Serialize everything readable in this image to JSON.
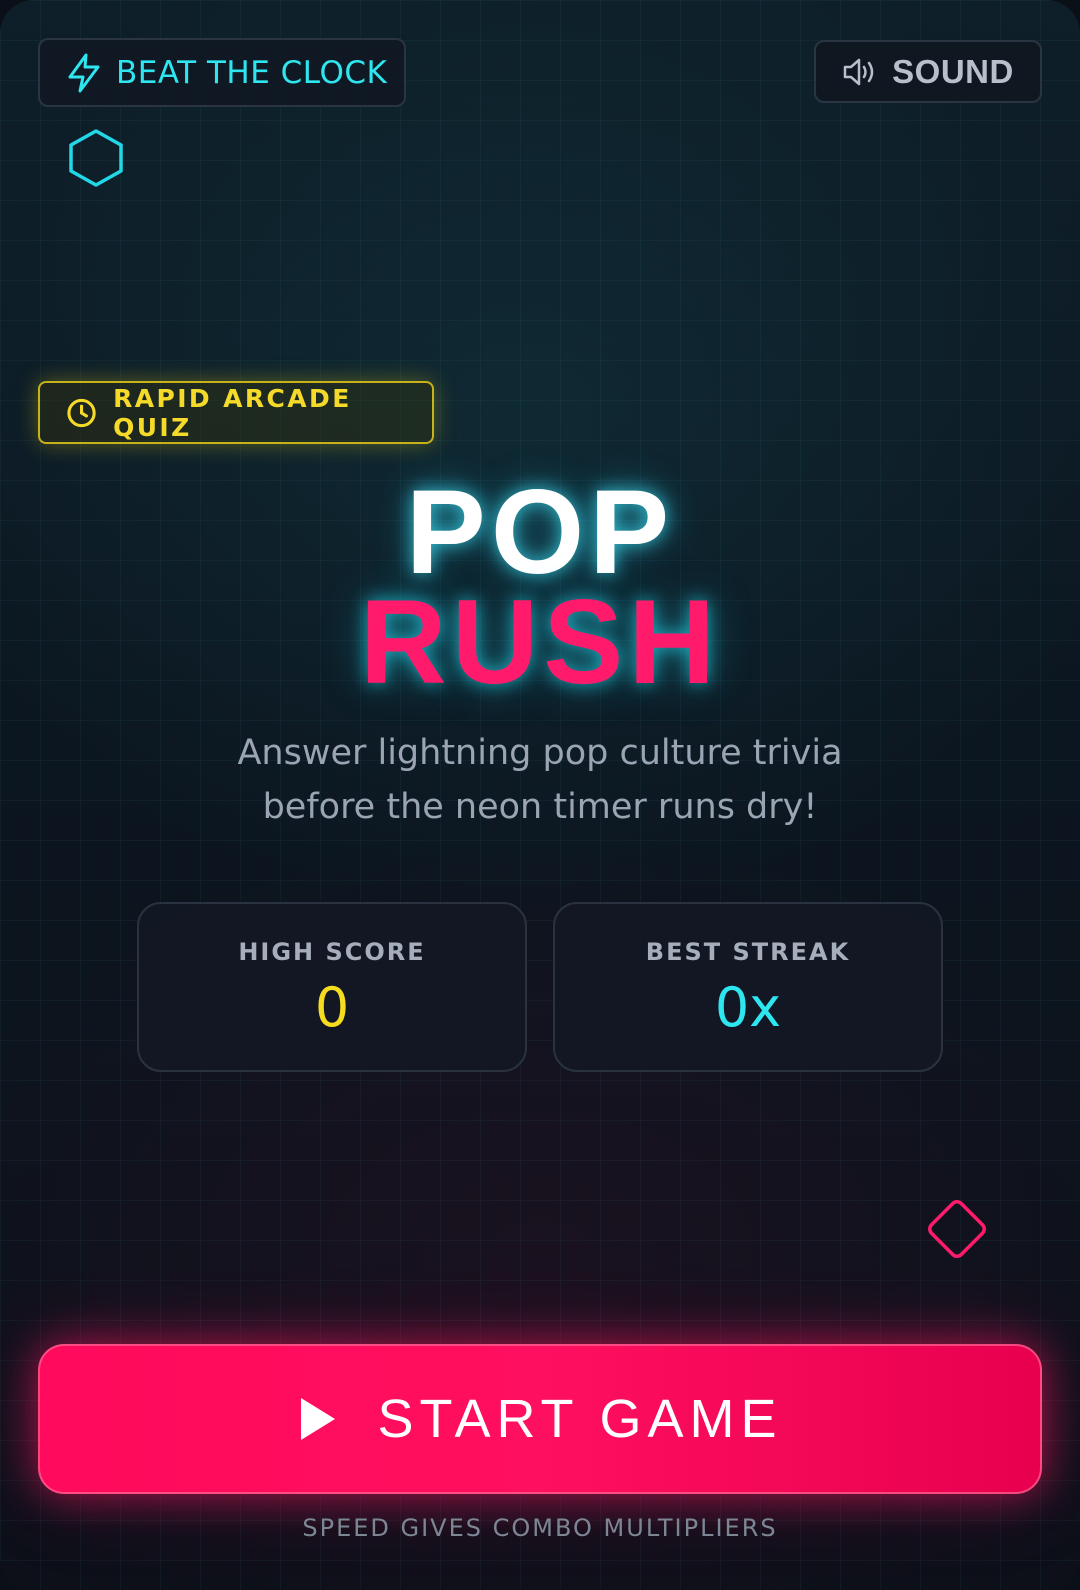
{
  "header": {
    "mode_label": "BEAT THE CLOCK",
    "sound_label": "SOUND"
  },
  "badge": {
    "label": "RAPID ARCADE QUIZ"
  },
  "title": {
    "line1": "POP",
    "line2": "RUSH"
  },
  "tagline": {
    "line1": "Answer lightning pop culture trivia",
    "line2": "before the neon timer runs dry!"
  },
  "stats": {
    "high_score": {
      "label": "HIGH SCORE",
      "value": "0"
    },
    "best_streak": {
      "label": "BEST STREAK",
      "value": "0x"
    }
  },
  "start": {
    "label": "START GAME"
  },
  "footer": {
    "hint": "SPEED GIVES COMBO MULTIPLIERS"
  },
  "icons": {
    "mode": "lightning-icon",
    "sound": "speaker-icon",
    "badge": "clock-icon",
    "start": "play-icon",
    "deco_top": "hexagon-icon",
    "deco_bottom": "diamond-icon"
  },
  "colors": {
    "cyan": "#2ee6f0",
    "pink": "#ff1a6b",
    "yellow": "#f5dc1e"
  }
}
